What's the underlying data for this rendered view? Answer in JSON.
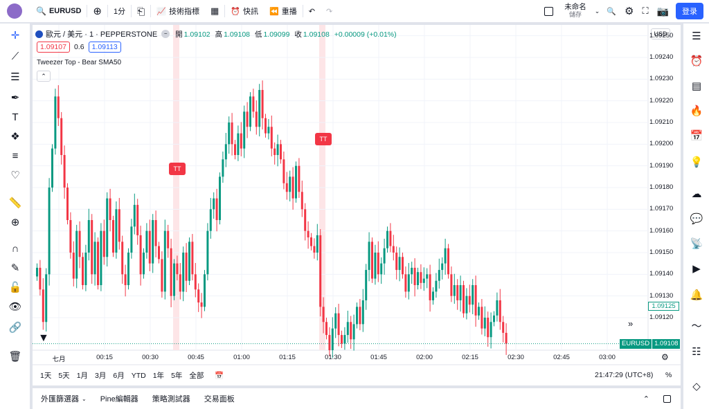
{
  "topbar": {
    "symbol": "EURUSD",
    "interval": "1分",
    "indicators_label": "技術指標",
    "alert_label": "快訊",
    "replay_label": "重播",
    "layout_name": "未命名",
    "save_label": "儲存",
    "login_label": "登录"
  },
  "legend": {
    "instrument": "歐元 / 美元 · 1 · PEPPERSTONE",
    "open_label": "開",
    "open": "1.09102",
    "high_label": "高",
    "high": "1.09108",
    "low_label": "低",
    "low": "1.09099",
    "close_label": "收",
    "close": "1.09108",
    "change": "+0.00009 (+0.01%)",
    "bid": "1.09107",
    "spread": "0.6",
    "ask": "1.09113",
    "indicators_line": "Tweezer Top - Bear SMA50"
  },
  "markers": [
    "TT",
    "TT"
  ],
  "price_axis": {
    "currency": "USD",
    "labels": [
      "1.09250",
      "1.09240",
      "1.09230",
      "1.09220",
      "1.09210",
      "1.09200",
      "1.09190",
      "1.09180",
      "1.09170",
      "1.09160",
      "1.09150",
      "1.09140",
      "1.09130",
      "1.09120"
    ],
    "sma_value": "1.09125",
    "last_symbol": "EURUSD",
    "last_price": "1.09108"
  },
  "time_axis": {
    "labels": [
      "七月",
      "00:15",
      "00:30",
      "00:45",
      "01:00",
      "01:15",
      "01:30",
      "01:45",
      "02:00",
      "02:15",
      "02:30",
      "02:45",
      "03:00"
    ]
  },
  "range_bar": {
    "ranges": [
      "1天",
      "5天",
      "1月",
      "3月",
      "6月",
      "YTD",
      "1年",
      "5年",
      "全部"
    ],
    "clock": "21:47:29 (UTC+8)",
    "percent": "%"
  },
  "bottom_panel": {
    "tabs": [
      "外匯篩選器",
      "Pine編輯器",
      "策略測試器",
      "交易面板"
    ]
  },
  "colors": {
    "up": "#089981",
    "down": "#f23645",
    "accent": "#2962ff"
  },
  "chart_data": {
    "type": "candlestick",
    "ylim": [
      1.09105,
      1.09255
    ],
    "closes": [
      1.09143,
      1.09133,
      1.09118,
      1.0914,
      1.0918,
      1.09198,
      1.09222,
      1.09212,
      1.09195,
      1.0918,
      1.09165,
      1.0915,
      1.09138,
      1.0916,
      1.09148,
      1.09135,
      1.0915,
      1.09165,
      1.0914,
      1.09155,
      1.09135,
      1.0916,
      1.09148,
      1.09175,
      1.09165,
      1.0915,
      1.0917,
      1.09155,
      1.0914,
      1.09135,
      1.0915,
      1.09162,
      1.09172,
      1.09158,
      1.0914,
      1.0915,
      1.0916,
      1.09145,
      1.09165,
      1.09153,
      1.09147,
      1.09132,
      1.0916,
      1.09152,
      1.0913,
      1.09145,
      1.0914,
      1.09132,
      1.0915,
      1.09137,
      1.09155,
      1.0914,
      1.09133,
      1.09127,
      1.09125,
      1.0914,
      1.0916,
      1.0917,
      1.09175,
      1.09165,
      1.09185,
      1.09193,
      1.092,
      1.0921,
      1.092,
      1.09195,
      1.09205,
      1.09198,
      1.09215,
      1.09208,
      1.09222,
      1.09215,
      1.09208,
      1.09225,
      1.09212,
      1.09205,
      1.09208,
      1.09198,
      1.09195,
      1.092,
      1.09193,
      1.09182,
      1.09178,
      1.09185,
      1.09175,
      1.0919,
      1.09178,
      1.0917,
      1.0916,
      1.09157,
      1.09153,
      1.0915,
      1.09158,
      1.09125,
      1.09118,
      1.09112,
      1.09105,
      1.09115,
      1.09122,
      1.09112,
      1.09108,
      1.09112,
      1.09118,
      1.0911,
      1.09117,
      1.09125,
      1.09117,
      1.09128,
      1.09142,
      1.09155,
      1.09138,
      1.0915,
      1.0914,
      1.09145,
      1.09152,
      1.0916,
      1.09153,
      1.0915,
      1.09142,
      1.09148,
      1.0914,
      1.09132,
      1.0914,
      1.09143,
      1.09135,
      1.09141,
      1.09136,
      1.09138,
      1.0914,
      1.09128,
      1.09132,
      1.09137,
      1.09142,
      1.09145,
      1.09152,
      1.0914,
      1.0913,
      1.09135,
      1.09128,
      1.09135,
      1.09122,
      1.0913,
      1.09126,
      1.09135,
      1.09121,
      1.09125,
      1.09115,
      1.0912,
      1.09111,
      1.09118,
      1.09121,
      1.09128,
      1.09118,
      1.09113,
      1.09108
    ]
  }
}
